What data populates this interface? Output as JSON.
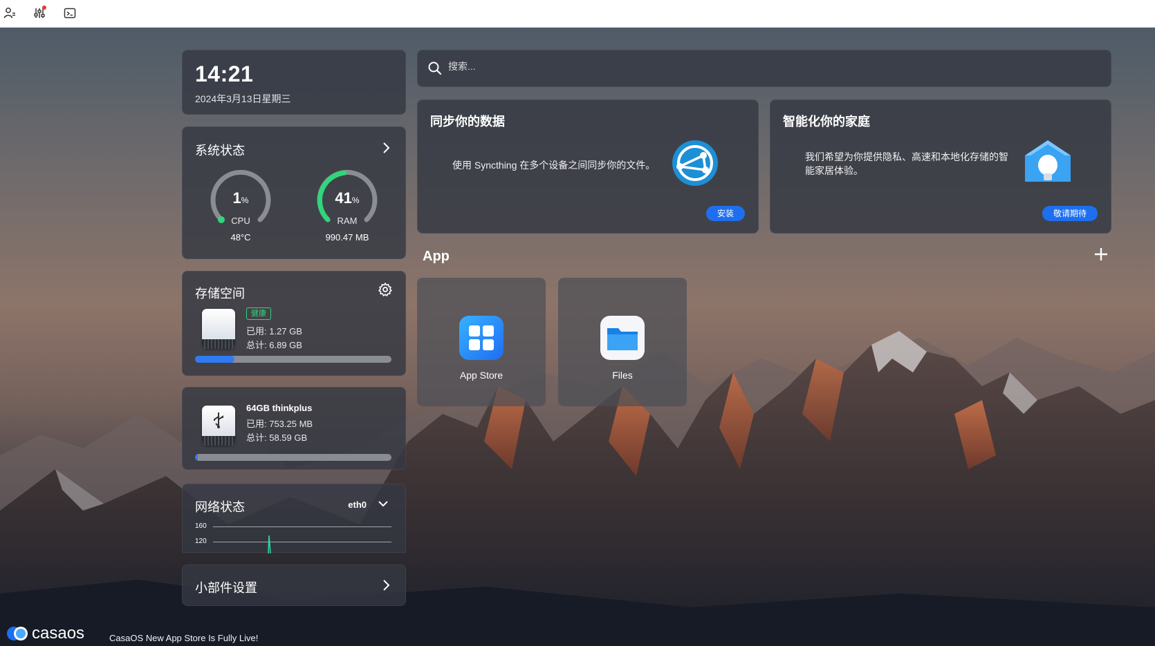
{
  "topbar": {
    "icons": [
      "account-icon",
      "settings-sliders-icon",
      "terminal-icon"
    ]
  },
  "clock": {
    "time": "14:21",
    "date": "2024年3月13日星期三"
  },
  "system_status": {
    "title": "系统状态",
    "cpu": {
      "value": "1",
      "unit": "%",
      "label": "CPU",
      "sub": "48°C",
      "percent": 1
    },
    "ram": {
      "value": "41",
      "unit": "%",
      "label": "RAM",
      "sub": "990.47 MB",
      "percent": 41
    }
  },
  "storage": {
    "title": "存储空间",
    "drives": [
      {
        "name": "",
        "badge": "健康",
        "used": "已用: 1.27 GB",
        "total": "总计: 6.89 GB",
        "fraction": 0.2
      },
      {
        "name": "64GB thinkplus",
        "badge": "",
        "used": "已用: 753.25 MB",
        "total": "总计: 58.59 GB",
        "fraction": 0.013
      }
    ]
  },
  "network": {
    "title": "网络状态",
    "interface": "eth0",
    "axis": [
      "160",
      "120"
    ]
  },
  "widget_settings": {
    "title": "小部件设置"
  },
  "search": {
    "placeholder": "搜索..."
  },
  "promos": [
    {
      "title": "同步你的数据",
      "text": "使用 Syncthing 在多个设备之间同步你的文件。",
      "button": "安装"
    },
    {
      "title": "智能化你的家庭",
      "text": "我们希望为你提供隐私、高速和本地化存储的智能家居体验。",
      "button": "敬请期待"
    }
  ],
  "apps": {
    "title": "App",
    "items": [
      {
        "label": "App Store",
        "icon": "app-store-icon"
      },
      {
        "label": "Files",
        "icon": "files-icon"
      }
    ]
  },
  "footer": {
    "brand": "casaos",
    "text": "CasaOS New App Store Is Fully Live!"
  },
  "colors": {
    "accent": "#1e6ff0",
    "cpu": "#2fd67a",
    "ram": "#2fd67a",
    "healthy": "#2fd67a"
  }
}
